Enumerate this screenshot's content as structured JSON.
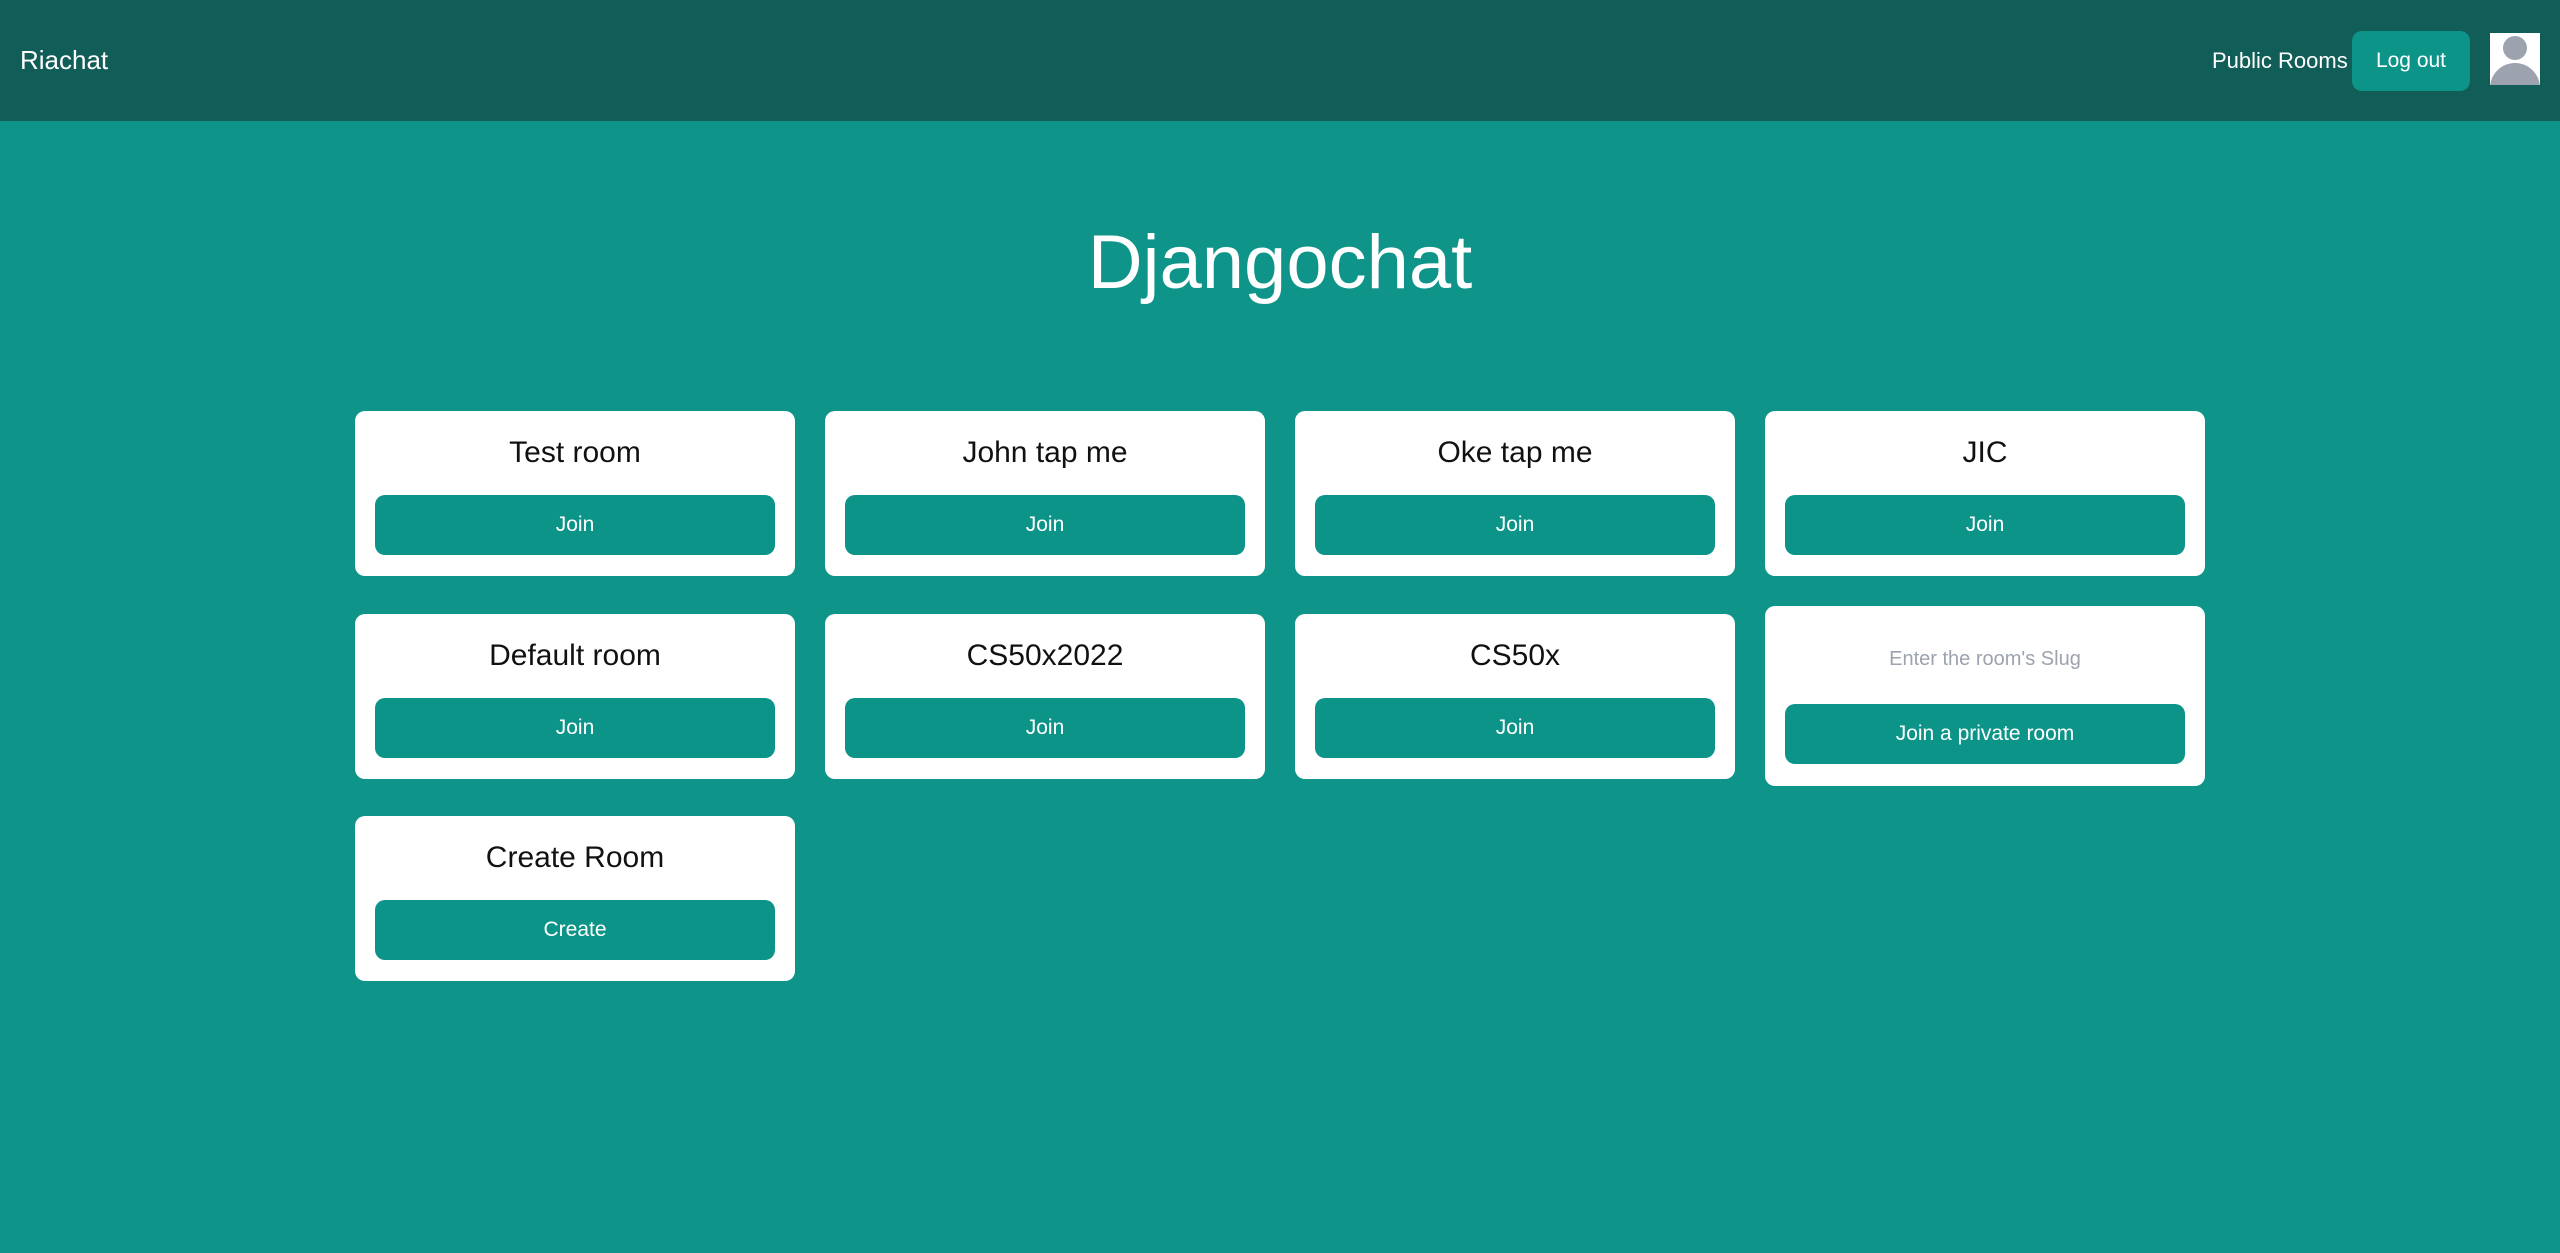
{
  "nav": {
    "brand": "Riachat",
    "public_rooms_label": "Public Rooms",
    "logout_label": "Log out"
  },
  "page": {
    "title": "Djangochat"
  },
  "rooms": [
    {
      "name": "Test room",
      "button": "Join"
    },
    {
      "name": "John tap me",
      "button": "Join"
    },
    {
      "name": "Oke tap me",
      "button": "Join"
    },
    {
      "name": "JIC",
      "button": "Join"
    },
    {
      "name": "Default room",
      "button": "Join"
    },
    {
      "name": "CS50x2022",
      "button": "Join"
    },
    {
      "name": "CS50x",
      "button": "Join"
    }
  ],
  "private_room": {
    "placeholder": "Enter the room's Slug",
    "button": "Join a private room"
  },
  "create_room": {
    "title": "Create Room",
    "button": "Create"
  },
  "colors": {
    "background": "#0e9488",
    "navbar": "#115e59",
    "button": "#0d9488",
    "card": "#ffffff"
  },
  "icons": {
    "avatar": "user-avatar-icon"
  }
}
